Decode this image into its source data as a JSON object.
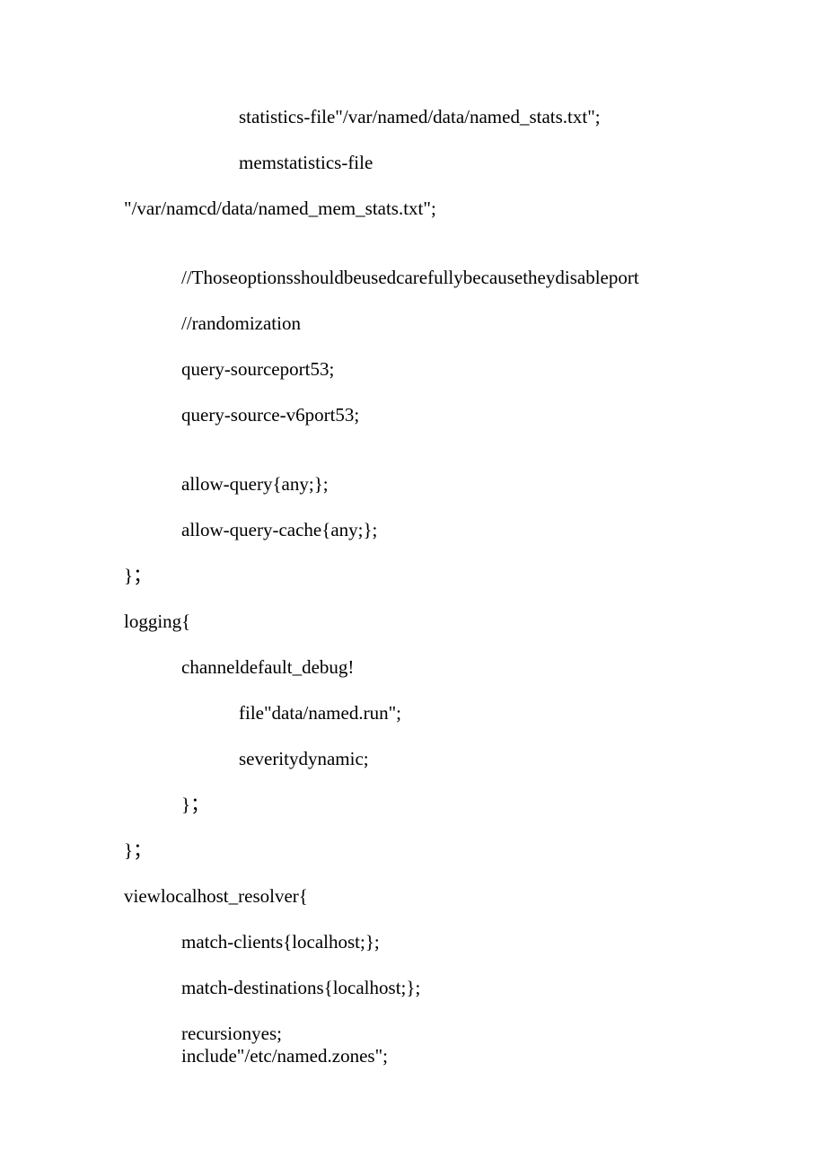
{
  "lines": {
    "l1": "statistics-file\"/var/named/data/named_stats.txt\";",
    "l2": "memstatistics-file",
    "l3": "\"/var/namcd/data/named_mem_stats.txt\";",
    "l4": "//Thoseoptionsshouldbeusedcarefullybecausetheydisableport",
    "l5": "//randomization",
    "l6": "query-sourceport53;",
    "l7": "query-source-v6port53;",
    "l8": "allow-query{any;};",
    "l9": "allow-query-cache{any;};",
    "l10": "}；",
    "l11": "logging{",
    "l12": "channeldefault_debug!",
    "l13": "file\"data/named.run\";",
    "l14": "severitydynamic;",
    "l15": "}；",
    "l16": "}；",
    "l17": "viewlocalhost_resolver{",
    "l18": "match-clients{localhost;};",
    "l19": "match-destinations{localhost;};",
    "l20": "recursionyes;",
    "l21": "include\"/etc/named.zones\";"
  }
}
